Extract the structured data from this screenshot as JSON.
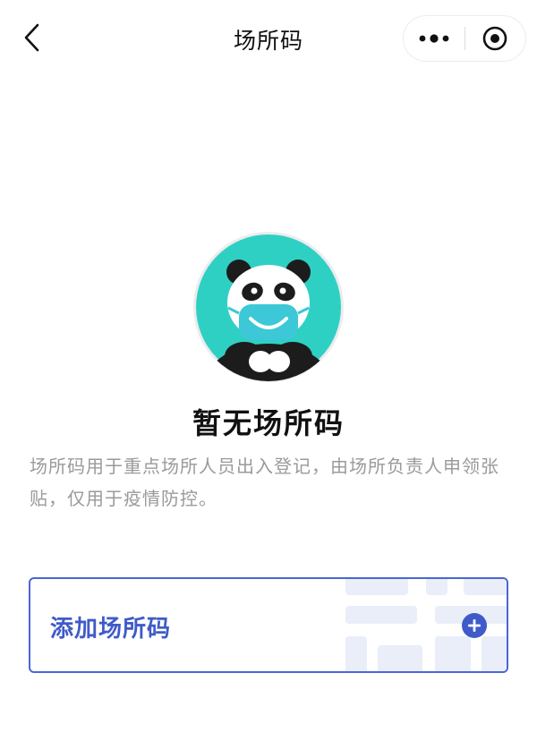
{
  "navbar": {
    "title": "场所码",
    "back_icon": "chevron-left-icon",
    "more_icon": "more-dots-icon",
    "close_icon": "target-close-icon"
  },
  "empty_state": {
    "illustration": "panda-mask-illustration",
    "title": "暂无场所码",
    "description": "场所码用于重点场所人员出入登记，由场所负责人申领张贴，仅用于疫情防控。"
  },
  "add_card": {
    "label": "添加场所码",
    "icon": "plus-circle-icon"
  },
  "colors": {
    "accent": "#3f5bc9",
    "panda_bg": "#2fd0c4",
    "text_primary": "#111111",
    "text_secondary": "#9a9a9a"
  }
}
